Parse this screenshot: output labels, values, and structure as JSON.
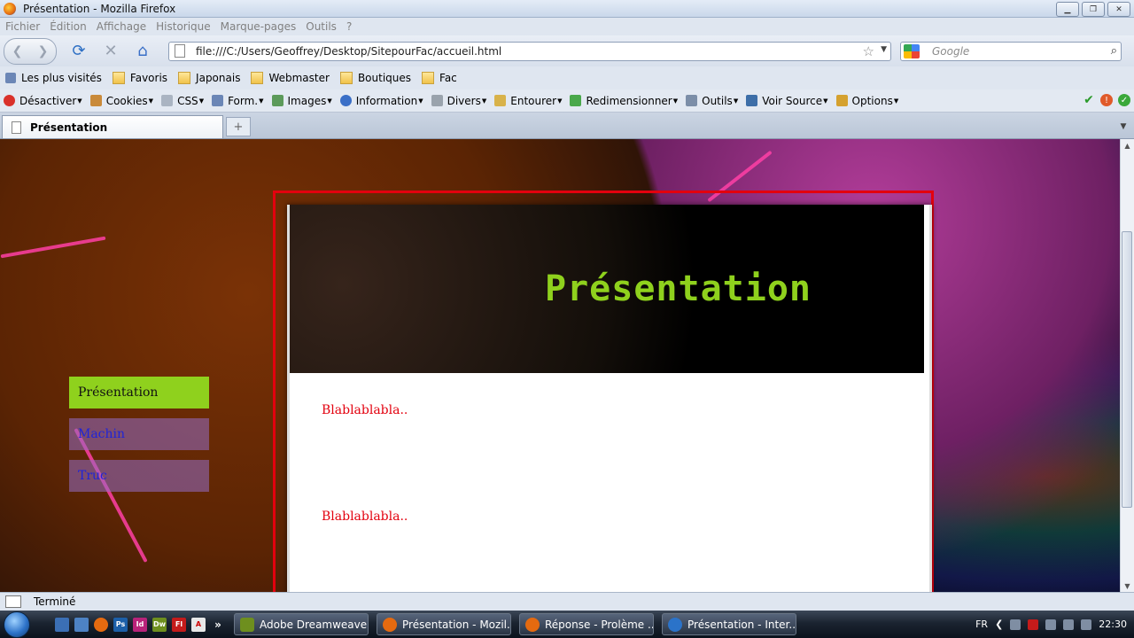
{
  "window": {
    "title": "Présentation - Mozilla Firefox"
  },
  "menu_bar": [
    "Fichier",
    "Édition",
    "Affichage",
    "Historique",
    "Marque-pages",
    "Outils",
    "?"
  ],
  "nav": {
    "url": "file:///C:/Users/Geoffrey/Desktop/SitepourFac/accueil.html",
    "search_placeholder": "Google"
  },
  "bookmarks": [
    {
      "label": "Les plus visités",
      "icon": "most-visited-icon"
    },
    {
      "label": "Favoris",
      "icon": "folder-icon"
    },
    {
      "label": "Japonais",
      "icon": "folder-icon"
    },
    {
      "label": "Webmaster",
      "icon": "folder-icon"
    },
    {
      "label": "Boutiques",
      "icon": "folder-icon"
    },
    {
      "label": "Fac",
      "icon": "folder-icon"
    }
  ],
  "webdev_toolbar": [
    {
      "label": "Désactiver",
      "color": "#d9312b"
    },
    {
      "label": "Cookies",
      "color": "#c98a3a"
    },
    {
      "label": "CSS",
      "color": "#aab4c2"
    },
    {
      "label": "Form.",
      "color": "#6b86b6"
    },
    {
      "label": "Images",
      "color": "#5c9a5a"
    },
    {
      "label": "Information",
      "color": "#3a6fc7"
    },
    {
      "label": "Divers",
      "color": "#9aa3ad"
    },
    {
      "label": "Entourer",
      "color": "#d8b24a"
    },
    {
      "label": "Redimensionner",
      "color": "#49a84b"
    },
    {
      "label": "Outils",
      "color": "#7c8ea8"
    },
    {
      "label": "Voir Source",
      "color": "#3d6ea8"
    },
    {
      "label": "Options",
      "color": "#d5a12f"
    }
  ],
  "tab": {
    "label": "Présentation"
  },
  "page": {
    "banner_title": "Présentation",
    "menu": [
      {
        "label": "Présentation",
        "active": true
      },
      {
        "label": "Machin",
        "active": false
      },
      {
        "label": "Truc",
        "active": false
      }
    ],
    "paragraphs": [
      "Blablablabla..",
      "Blablablabla.."
    ],
    "colors": {
      "accent_green": "#8fd11d",
      "frame_red": "#e3000e",
      "link_blue": "#1f24d8"
    }
  },
  "status": {
    "text": "Terminé"
  },
  "taskbar": {
    "buttons": [
      {
        "label": "Adobe Dreamweave...",
        "color": "#6e8f1e"
      },
      {
        "label": "Présentation - Mozil...",
        "color": "#e56a10"
      },
      {
        "label": "Réponse - Prolème ...",
        "color": "#e56a10"
      },
      {
        "label": "Présentation - Inter...",
        "color": "#2b73c9"
      }
    ],
    "lang": "FR",
    "clock": "22:30"
  }
}
